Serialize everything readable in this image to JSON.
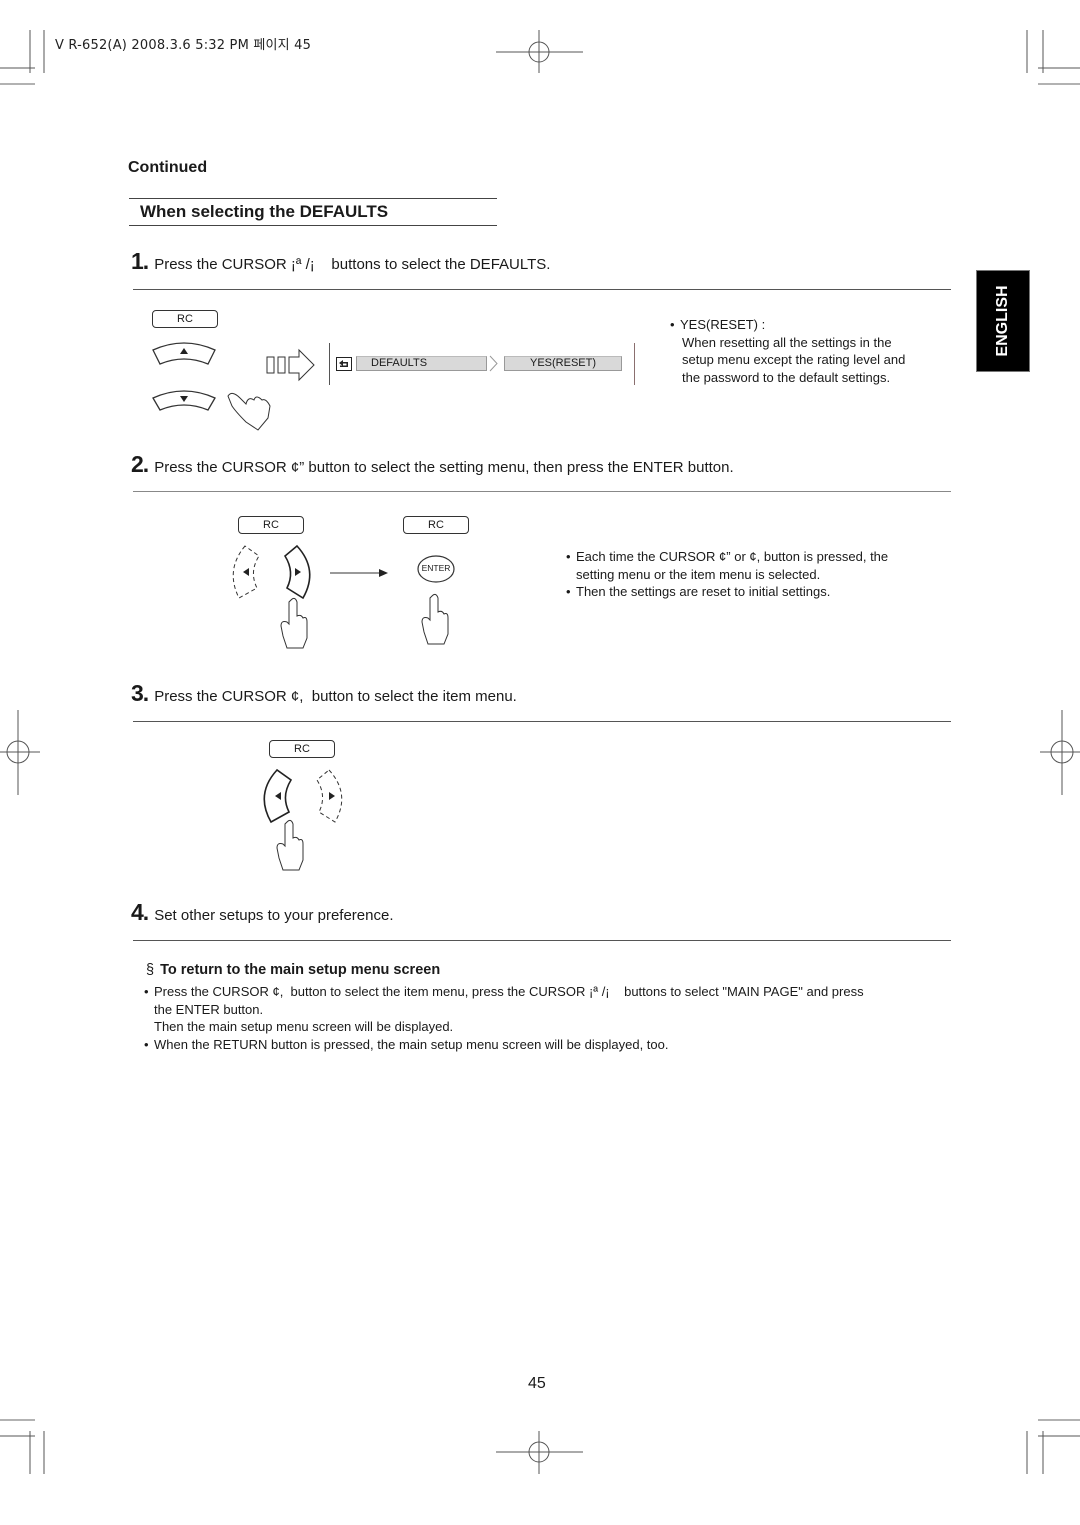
{
  "header_stamp": "V R-652(A)  2008.3.6  5:32 PM 페이지 45",
  "continued": "Continued",
  "section_title": "When selecting the DEFAULTS",
  "language_tab": "ENGLISH",
  "steps": [
    {
      "num": "1.",
      "text": "Press the CURSOR ¡ª /¡    buttons to select the DEFAULTS."
    },
    {
      "num": "2.",
      "text": "Press the CURSOR ¢” button to select the setting menu, then press the ENTER button."
    },
    {
      "num": "3.",
      "text": "Press the CURSOR ¢,  button to select the item menu."
    },
    {
      "num": "4.",
      "text": "Set other setups to your preference."
    }
  ],
  "step1_figure": {
    "rc_label": "RC",
    "menu_item": "DEFAULTS",
    "menu_value": "YES(RESET)",
    "icons": [
      "cursor-up-button",
      "cursor-down-button",
      "pointing-hand",
      "hollow-arrow",
      "return-icon",
      "menu-chevron"
    ]
  },
  "step1_note": {
    "bullet": "•",
    "title": "YES(RESET) :",
    "lines": [
      "When resetting all the settings in the",
      "setup menu except the rating level and",
      "the password to the default settings."
    ]
  },
  "step2_figure": {
    "rc_label_left": "RC",
    "rc_label_right": "RC",
    "enter_label": "ENTER"
  },
  "step2_notes": [
    {
      "bullet": "•",
      "lines": [
        "Each time the CURSOR ¢” or ¢,  button is pressed, the",
        "setting menu or the item menu is selected."
      ]
    },
    {
      "bullet": "•",
      "lines": [
        "Then the settings are reset to initial settings."
      ]
    }
  ],
  "step3_figure": {
    "rc_label": "RC"
  },
  "return_section": {
    "symbol": "§",
    "title": "To return to the main setup menu screen",
    "items": [
      {
        "bullet": "•",
        "lines": [
          "Press the CURSOR ¢,  button to select the item menu, press the CURSOR ¡ª /¡    buttons to select \"MAIN PAGE\" and press",
          "the ENTER button.",
          "Then the main setup menu screen will be displayed."
        ]
      },
      {
        "bullet": "•",
        "lines": [
          "When the RETURN button is pressed, the main setup menu screen will be displayed, too."
        ]
      }
    ]
  },
  "page_number": "45"
}
